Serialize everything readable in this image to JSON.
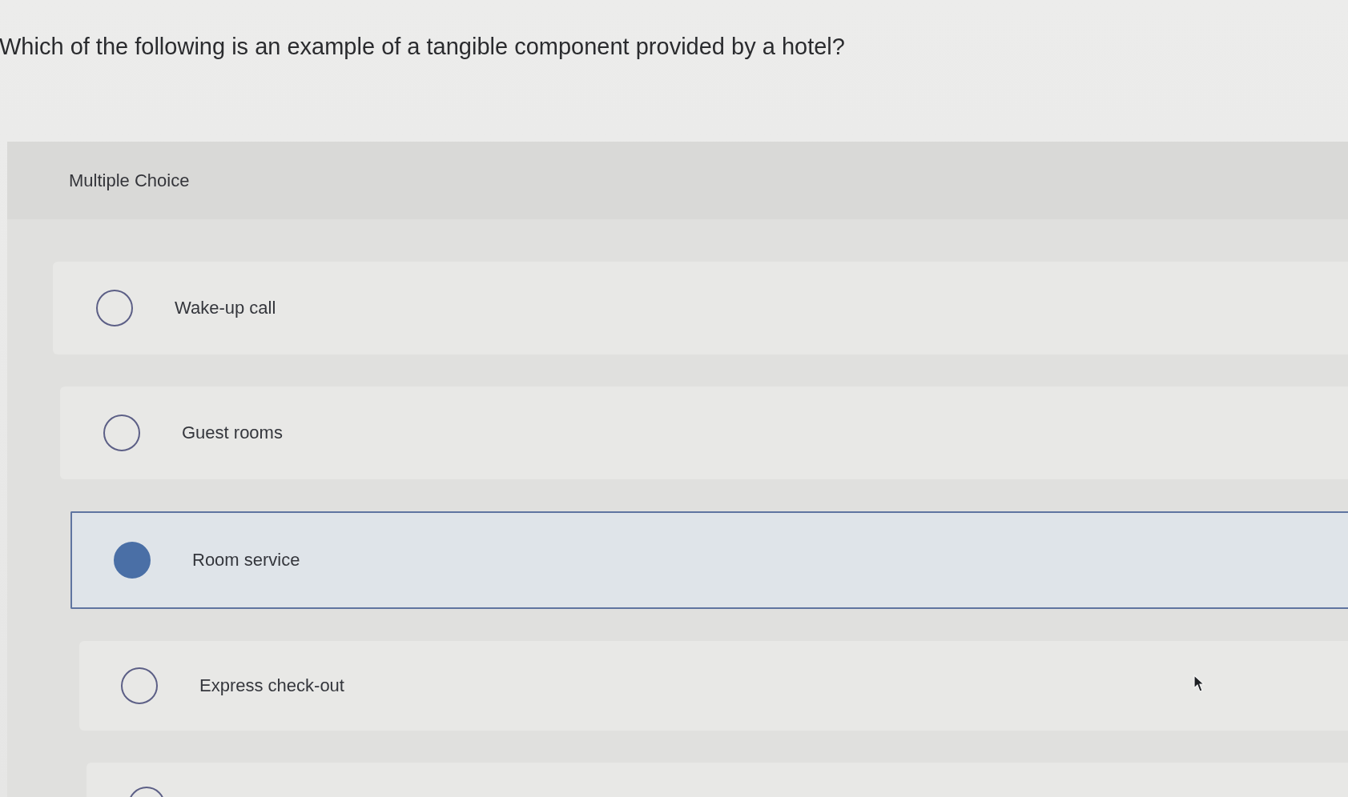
{
  "question": "Which of the following is an example of a tangible component provided by a hotel?",
  "panel": {
    "heading": "Multiple Choice"
  },
  "options": [
    {
      "label": "Wake-up call",
      "selected": false
    },
    {
      "label": "Guest rooms",
      "selected": false
    },
    {
      "label": "Room service",
      "selected": true
    },
    {
      "label": "Express check-out",
      "selected": false
    },
    {
      "selected": false
    }
  ]
}
